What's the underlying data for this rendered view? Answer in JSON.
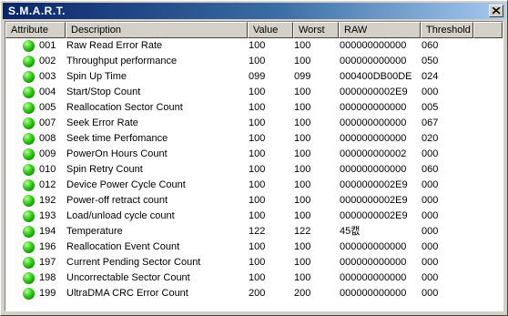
{
  "window": {
    "title": "S.M.A.R.T."
  },
  "columns": [
    "Attribute",
    "Description",
    "Value",
    "Worst",
    "RAW",
    "Threshold"
  ],
  "status_color": "#2bc41a",
  "rows": [
    {
      "id": "001",
      "desc": "Raw Read Error Rate",
      "value": "100",
      "worst": "100",
      "raw": "000000000000",
      "threshold": "060"
    },
    {
      "id": "002",
      "desc": "Throughput performance",
      "value": "100",
      "worst": "100",
      "raw": "000000000000",
      "threshold": "050"
    },
    {
      "id": "003",
      "desc": "Spin Up Time",
      "value": "099",
      "worst": "099",
      "raw": "000400DB00DE",
      "threshold": "024"
    },
    {
      "id": "004",
      "desc": "Start/Stop Count",
      "value": "100",
      "worst": "100",
      "raw": "0000000002E9",
      "threshold": "000"
    },
    {
      "id": "005",
      "desc": "Reallocation Sector Count",
      "value": "100",
      "worst": "100",
      "raw": "000000000000",
      "threshold": "005"
    },
    {
      "id": "007",
      "desc": "Seek Error Rate",
      "value": "100",
      "worst": "100",
      "raw": "000000000000",
      "threshold": "067"
    },
    {
      "id": "008",
      "desc": "Seek time Perfomance",
      "value": "100",
      "worst": "100",
      "raw": "000000000000",
      "threshold": "020"
    },
    {
      "id": "009",
      "desc": "PowerOn Hours Count",
      "value": "100",
      "worst": "100",
      "raw": "000000000002",
      "threshold": "000"
    },
    {
      "id": "010",
      "desc": "Spin Retry Count",
      "value": "100",
      "worst": "100",
      "raw": "000000000000",
      "threshold": "060"
    },
    {
      "id": "012",
      "desc": "Device Power Cycle Count",
      "value": "100",
      "worst": "100",
      "raw": "0000000002E9",
      "threshold": "000"
    },
    {
      "id": "192",
      "desc": "Power-off retract count",
      "value": "100",
      "worst": "100",
      "raw": "0000000002E9",
      "threshold": "000"
    },
    {
      "id": "193",
      "desc": "Load/unload cycle count",
      "value": "100",
      "worst": "100",
      "raw": "0000000002E9",
      "threshold": "000"
    },
    {
      "id": "194",
      "desc": "Temperature",
      "value": "122",
      "worst": "122",
      "raw": "45캢",
      "threshold": "000"
    },
    {
      "id": "196",
      "desc": "Reallocation Event Count",
      "value": "100",
      "worst": "100",
      "raw": "000000000000",
      "threshold": "000"
    },
    {
      "id": "197",
      "desc": "Current Pending Sector Count",
      "value": "100",
      "worst": "100",
      "raw": "000000000000",
      "threshold": "000"
    },
    {
      "id": "198",
      "desc": "Uncorrectable Sector Count",
      "value": "100",
      "worst": "100",
      "raw": "000000000000",
      "threshold": "000"
    },
    {
      "id": "199",
      "desc": "UltraDMA CRC Error Count",
      "value": "200",
      "worst": "200",
      "raw": "000000000000",
      "threshold": "000"
    }
  ]
}
